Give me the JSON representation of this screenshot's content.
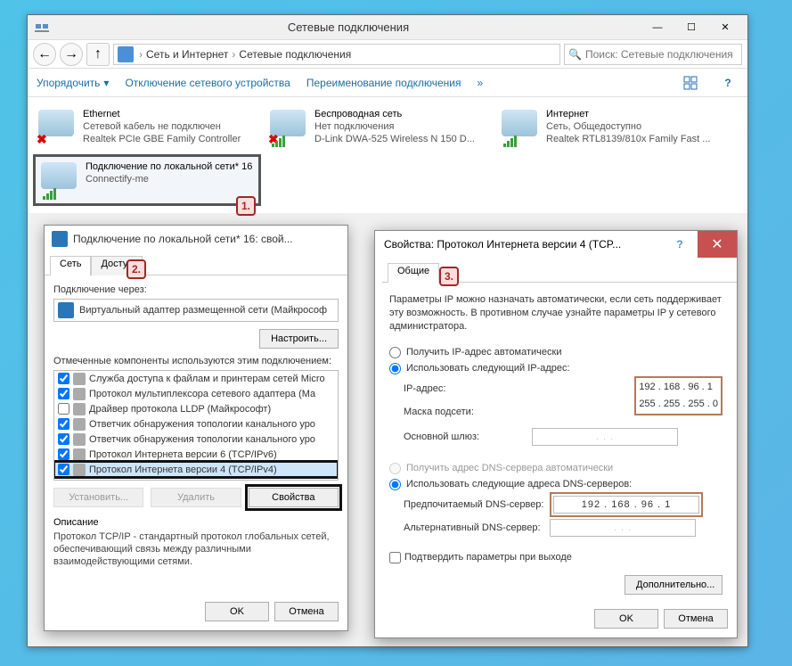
{
  "window": {
    "title": "Сетевые подключения",
    "breadcrumb": [
      "Сеть и Интернет",
      "Сетевые подключения"
    ],
    "search_placeholder": "Поиск: Сетевые подключения"
  },
  "commands": {
    "organize": "Упорядочить",
    "disable": "Отключение сетевого устройства",
    "rename": "Переименование подключения"
  },
  "adapters": [
    {
      "name": "Ethernet",
      "status": "Сетевой кабель не подключен",
      "device": "Realtek PCIe GBE Family Controller",
      "icon": "strike"
    },
    {
      "name": "Беспроводная сеть",
      "status": "Нет подключения",
      "device": "D-Link DWA-525 Wireless N 150 D...",
      "icon": "strike-bars"
    },
    {
      "name": "Интернет",
      "status": "Сеть, Общедоступно",
      "device": "Realtek RTL8139/810x Family Fast ...",
      "icon": "bars"
    },
    {
      "name": "Подключение по локальной сети* 16",
      "status": "",
      "device": "Connectify-me",
      "icon": "bars",
      "selected": true
    }
  ],
  "annotations": {
    "a1": "1.",
    "a2": "2.",
    "a3": "3."
  },
  "dialog1": {
    "title": "Подключение по локальной сети* 16: свой...",
    "tabs": {
      "net": "Сеть",
      "access": "Доступ"
    },
    "conn_label": "Подключение через:",
    "conn_value": "Виртуальный адаптер размещенной сети (Майкрософ",
    "configure": "Настроить...",
    "components_label": "Отмеченные компоненты используются этим подключением:",
    "components": [
      {
        "checked": true,
        "name": "Служба доступа к файлам и принтерам сетей Micro"
      },
      {
        "checked": true,
        "name": "Протокол мультиплексора сетевого адаптера (Ма"
      },
      {
        "checked": false,
        "name": "Драйвер протокола LLDP (Майкрософт)"
      },
      {
        "checked": true,
        "name": "Ответчик обнаружения топологии канального уро"
      },
      {
        "checked": true,
        "name": "Ответчик обнаружения топологии канального уро"
      },
      {
        "checked": true,
        "name": "Протокол Интернета версии 6 (TCP/IPv6)"
      },
      {
        "checked": true,
        "name": "Протокол Интернета версии 4 (TCP/IPv4)",
        "selected": true
      }
    ],
    "buttons": {
      "install": "Установить...",
      "uninstall": "Удалить",
      "properties": "Свойства"
    },
    "desc_hdr": "Описание",
    "desc_body": "Протокол TCP/IP - стандартный протокол глобальных сетей, обеспечивающий связь между различными взаимодействующими сетями.",
    "ok": "OK",
    "cancel": "Отмена"
  },
  "dialog2": {
    "title": "Свойства: Протокол Интернета версии 4 (TCP...",
    "tab": "Общие",
    "intro": "Параметры IP можно назначать автоматически, если сеть поддерживает эту возможность. В противном случае узнайте параметры IP у сетевого администратора.",
    "r_auto_ip": "Получить IP-адрес автоматически",
    "r_manual_ip": "Использовать следующий IP-адрес:",
    "ip_label": "IP-адрес:",
    "ip_value": "192 . 168 . 96 . 1",
    "mask_label": "Маска подсети:",
    "mask_value": "255 . 255 . 255 . 0",
    "gateway_label": "Основной шлюз:",
    "gateway_value": ".   .   .",
    "r_auto_dns": "Получить адрес DNS-сервера автоматически",
    "r_manual_dns": "Использовать следующие адреса DNS-серверов:",
    "dns1_label": "Предпочитаемый DNS-сервер:",
    "dns1_value": "192 . 168 . 96 . 1",
    "dns2_label": "Альтернативный DNS-сервер:",
    "dns2_value": ".   .   .",
    "confirm": "Подтвердить параметры при выходе",
    "advanced": "Дополнительно...",
    "ok": "OK",
    "cancel": "Отмена"
  }
}
